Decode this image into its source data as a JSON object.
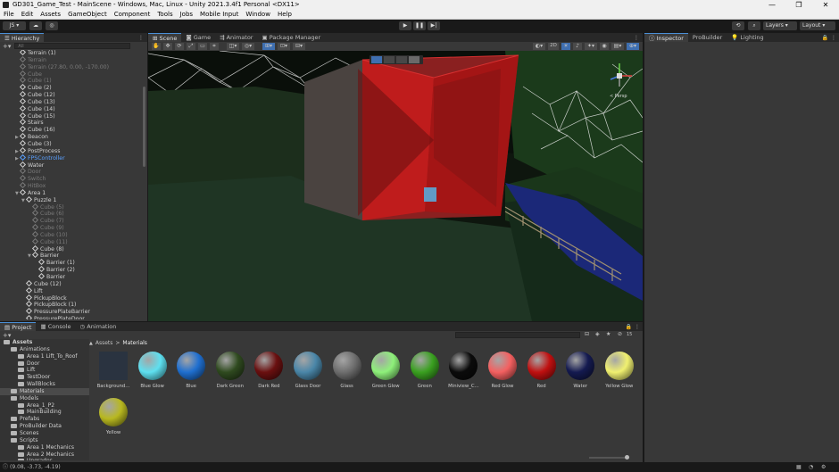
{
  "window": {
    "title": "GD301_Game_Test - MainScene - Windows, Mac, Linux - Unity 2021.3.4f1 Personal <DX11>",
    "min": "—",
    "max": "❐",
    "close": "✕"
  },
  "menu": [
    "File",
    "Edit",
    "Assets",
    "GameObject",
    "Component",
    "Tools",
    "Jobs",
    "Mobile Input",
    "Window",
    "Help"
  ],
  "toolbar": {
    "account": "JS ▾",
    "layers": "Layers",
    "layout": "Layout"
  },
  "hierarchy": {
    "tab": "Hierarchy",
    "search_placeholder": "All",
    "items": [
      {
        "label": "Terrain (1)",
        "indent": 0,
        "style": "normal",
        "fold": ""
      },
      {
        "label": "Terrain",
        "indent": 0,
        "style": "dim",
        "fold": ""
      },
      {
        "label": "Terrain (27.80, 0.00, -170.00)",
        "indent": 0,
        "style": "dim",
        "fold": ""
      },
      {
        "label": "Cube",
        "indent": 0,
        "style": "dim",
        "fold": ""
      },
      {
        "label": "Cube (1)",
        "indent": 0,
        "style": "dim",
        "fold": ""
      },
      {
        "label": "Cube (2)",
        "indent": 0,
        "style": "normal",
        "fold": ""
      },
      {
        "label": "Cube (12)",
        "indent": 0,
        "style": "normal",
        "fold": ""
      },
      {
        "label": "Cube (13)",
        "indent": 0,
        "style": "normal",
        "fold": ""
      },
      {
        "label": "Cube (14)",
        "indent": 0,
        "style": "normal",
        "fold": ""
      },
      {
        "label": "Cube (15)",
        "indent": 0,
        "style": "normal",
        "fold": ""
      },
      {
        "label": "Stairs",
        "indent": 0,
        "style": "normal",
        "fold": ""
      },
      {
        "label": "Cube (16)",
        "indent": 0,
        "style": "normal",
        "fold": ""
      },
      {
        "label": "Beacon",
        "indent": 0,
        "style": "normal",
        "fold": "▶"
      },
      {
        "label": "Cube (3)",
        "indent": 0,
        "style": "normal",
        "fold": ""
      },
      {
        "label": "PostProcess",
        "indent": 0,
        "style": "normal",
        "fold": "▶"
      },
      {
        "label": "FPSController",
        "indent": 0,
        "style": "blue",
        "fold": "▶"
      },
      {
        "label": "Water",
        "indent": 0,
        "style": "normal",
        "fold": ""
      },
      {
        "label": "Door",
        "indent": 0,
        "style": "dim",
        "fold": ""
      },
      {
        "label": "Switch",
        "indent": 0,
        "style": "dim",
        "fold": ""
      },
      {
        "label": "HitBox",
        "indent": 0,
        "style": "dim",
        "fold": ""
      },
      {
        "label": "Area 1",
        "indent": 0,
        "style": "normal",
        "fold": "▼"
      },
      {
        "label": "Puzzle 1",
        "indent": 1,
        "style": "normal",
        "fold": "▼"
      },
      {
        "label": "Cube (5)",
        "indent": 2,
        "style": "dim",
        "fold": ""
      },
      {
        "label": "Cube (6)",
        "indent": 2,
        "style": "dim",
        "fold": ""
      },
      {
        "label": "Cube (7)",
        "indent": 2,
        "style": "dim",
        "fold": ""
      },
      {
        "label": "Cube (9)",
        "indent": 2,
        "style": "dim",
        "fold": ""
      },
      {
        "label": "Cube (10)",
        "indent": 2,
        "style": "dim",
        "fold": ""
      },
      {
        "label": "Cube (11)",
        "indent": 2,
        "style": "dim",
        "fold": ""
      },
      {
        "label": "Cube (8)",
        "indent": 2,
        "style": "normal",
        "fold": ""
      },
      {
        "label": "Barrier",
        "indent": 2,
        "style": "normal",
        "fold": "▼"
      },
      {
        "label": "Barrier (1)",
        "indent": 3,
        "style": "normal",
        "fold": ""
      },
      {
        "label": "Barrier (2)",
        "indent": 3,
        "style": "normal",
        "fold": ""
      },
      {
        "label": "Barrier",
        "indent": 3,
        "style": "normal",
        "fold": ""
      },
      {
        "label": "Cube (12)",
        "indent": 1,
        "style": "normal",
        "fold": ""
      },
      {
        "label": "Lift",
        "indent": 1,
        "style": "normal",
        "fold": ""
      },
      {
        "label": "PickupBlock",
        "indent": 1,
        "style": "normal",
        "fold": ""
      },
      {
        "label": "PickupBlock (1)",
        "indent": 1,
        "style": "normal",
        "fold": ""
      },
      {
        "label": "PressurePlateBarrier",
        "indent": 1,
        "style": "normal",
        "fold": ""
      },
      {
        "label": "PressurePlateDoor",
        "indent": 1,
        "style": "normal",
        "fold": ""
      }
    ]
  },
  "scene": {
    "tabs": [
      "Scene",
      "Game",
      "Animator",
      "Package Manager"
    ],
    "mode_2d": "2D",
    "gizmo_label": "< Persp"
  },
  "inspector": {
    "tabs": [
      "Inspector",
      "ProBuilder",
      "Lighting"
    ]
  },
  "project": {
    "tabs": [
      "Project",
      "Console",
      "Animation"
    ],
    "breadcrumb": [
      "Assets",
      "Materials"
    ],
    "count": "15",
    "tree": [
      {
        "label": "Assets",
        "indent": 0,
        "bold": true,
        "sel": false
      },
      {
        "label": "Animations",
        "indent": 1,
        "bold": false,
        "sel": false
      },
      {
        "label": "Area 1 Lift_To_Roof",
        "indent": 2,
        "bold": false,
        "sel": false
      },
      {
        "label": "Door",
        "indent": 2,
        "bold": false,
        "sel": false
      },
      {
        "label": "Lift",
        "indent": 2,
        "bold": false,
        "sel": false
      },
      {
        "label": "TestDoor",
        "indent": 2,
        "bold": false,
        "sel": false
      },
      {
        "label": "WallBlocks",
        "indent": 2,
        "bold": false,
        "sel": false
      },
      {
        "label": "Materials",
        "indent": 1,
        "bold": false,
        "sel": true
      },
      {
        "label": "Models",
        "indent": 1,
        "bold": false,
        "sel": false
      },
      {
        "label": "Area_1_P2",
        "indent": 2,
        "bold": false,
        "sel": false
      },
      {
        "label": "MainBuilding",
        "indent": 2,
        "bold": false,
        "sel": false
      },
      {
        "label": "Prefabs",
        "indent": 1,
        "bold": false,
        "sel": false
      },
      {
        "label": "ProBuilder Data",
        "indent": 1,
        "bold": false,
        "sel": false
      },
      {
        "label": "Scenes",
        "indent": 1,
        "bold": false,
        "sel": false
      },
      {
        "label": "Scripts",
        "indent": 1,
        "bold": false,
        "sel": false
      },
      {
        "label": "Area 1 Mechanics",
        "indent": 2,
        "bold": false,
        "sel": false
      },
      {
        "label": "Area 2 Mechanics",
        "indent": 2,
        "bold": false,
        "sel": false
      },
      {
        "label": "Upgrades",
        "indent": 2,
        "bold": false,
        "sel": false
      }
    ],
    "assets": [
      {
        "label": "Background...",
        "color": "#2a3340",
        "type": "square"
      },
      {
        "label": "Blue Glow",
        "color": "#5ee0f0",
        "type": "sphere"
      },
      {
        "label": "Blue",
        "color": "#1f6fd0",
        "type": "sphere"
      },
      {
        "label": "Dark Green",
        "color": "#2f4a1f",
        "type": "sphere"
      },
      {
        "label": "Dark Red",
        "color": "#6a1010",
        "type": "sphere"
      },
      {
        "label": "Glass Door",
        "color": "#4a86a8",
        "type": "sphere"
      },
      {
        "label": "Glass",
        "color": "#6e6e6e",
        "type": "sphere"
      },
      {
        "label": "Green Glow",
        "color": "#8ef07a",
        "type": "sphere"
      },
      {
        "label": "Green",
        "color": "#3aa020",
        "type": "sphere"
      },
      {
        "label": "Miniview_C...",
        "color": "#0b0b0b",
        "type": "sphere"
      },
      {
        "label": "Red Glow",
        "color": "#f46060",
        "type": "sphere"
      },
      {
        "label": "Red",
        "color": "#c01010",
        "type": "sphere"
      },
      {
        "label": "Water",
        "color": "#141a50",
        "type": "sphere"
      },
      {
        "label": "Yellow Glow",
        "color": "#f0f070",
        "type": "sphere"
      },
      {
        "label": "Yellow",
        "color": "#b8b820",
        "type": "sphere"
      }
    ]
  },
  "status": {
    "coords": "(9.08, -3.73, -4.19)"
  },
  "colors": {
    "accent": "#4a8fd6",
    "panel": "#383838",
    "header": "#282828"
  }
}
